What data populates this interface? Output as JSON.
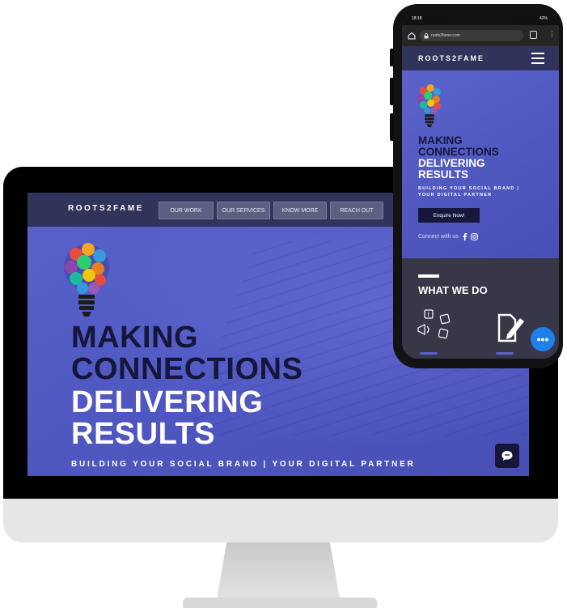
{
  "brand": "ROOTS2FAME",
  "desktop": {
    "nav_items": [
      "OUR WORK",
      "OUR SERVICES",
      "KNOW MORE",
      "REACH OUT"
    ],
    "headline": [
      "MAKING",
      "CONNECTIONS",
      "DELIVERING",
      "RESULTS"
    ],
    "tagline": "BUILDING YOUR SOCIAL BRAND | YOUR DIGITAL PARTNER"
  },
  "mobile": {
    "status_time": "18:18",
    "status_right": "42%",
    "url": "roots2fame.com",
    "headline": [
      "MAKING",
      "CONNECTIONS",
      "DELIVERING",
      "RESULTS"
    ],
    "tagline_lines": [
      "BUILDING YOUR SOCIAL BRAND |",
      "YOUR DIGITAL PARTNER"
    ],
    "enquire_label": "Enquire Now!",
    "connect_label": "Connect with us",
    "section_title": "WHAT WE DO",
    "fab_label": "•••"
  },
  "colors": {
    "hero_blue": "#5058c4",
    "nav_dark": "#30335a",
    "headline_dark": "#15163a",
    "headline_light": "#ffffff",
    "fab_blue": "#1e80e8"
  }
}
